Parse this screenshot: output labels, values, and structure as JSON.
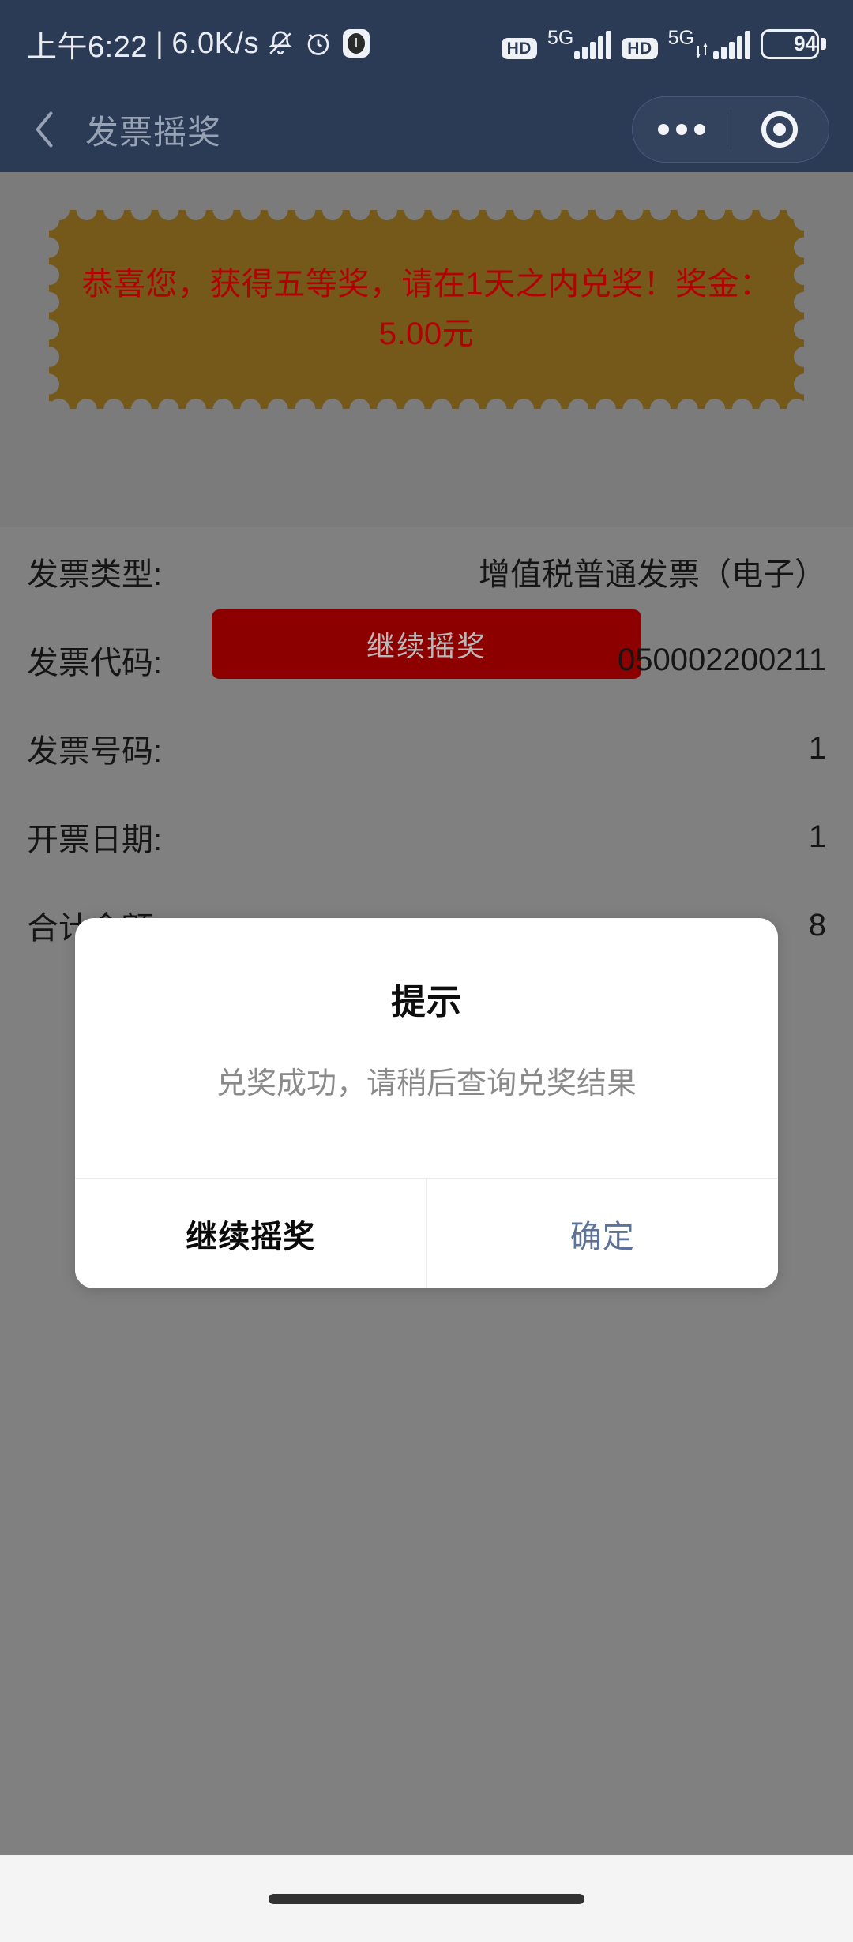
{
  "status_bar": {
    "time": "上午6:22",
    "separator": "|",
    "network_speed": "6.0K/s",
    "icons_left": [
      "bell-mute-icon",
      "alarm-icon",
      "app-dot-icon"
    ],
    "sim1_hd": "HD",
    "sim1_network": "5G",
    "sim2_hd": "HD",
    "sim2_network": "5G",
    "battery_percent": "94"
  },
  "header": {
    "back_icon": "chevron-left-icon",
    "title": "发票摇奖",
    "capsule": {
      "more_icon": "more-dots-icon",
      "target_icon": "target-circle-icon"
    }
  },
  "ticket": {
    "message": "恭喜您，获得五等奖，请在1天之内兑奖！奖金：5.00元",
    "background_color": "#75591B",
    "text_color": "#B30000"
  },
  "primary_button": {
    "label": "继续摇奖",
    "background_color": "#8D0000",
    "text_color": "#B9B9B9"
  },
  "invoice": {
    "rows": [
      {
        "label": "发票类型:",
        "value": "增值税普通发票（电子）"
      },
      {
        "label": "发票代码:",
        "value": "050002200211"
      },
      {
        "label": "发票号码:",
        "value": "1"
      },
      {
        "label": "开票日期:",
        "value": "1"
      },
      {
        "label": "合计金额:",
        "value": "8"
      }
    ]
  },
  "dialog": {
    "title": "提示",
    "message": "兑奖成功，请稍后查询兑奖结果",
    "cancel_label": "继续摇奖",
    "confirm_label": "确定",
    "confirm_color": "#5D7299"
  },
  "system": {
    "gesture_bar": "home-indicator"
  }
}
